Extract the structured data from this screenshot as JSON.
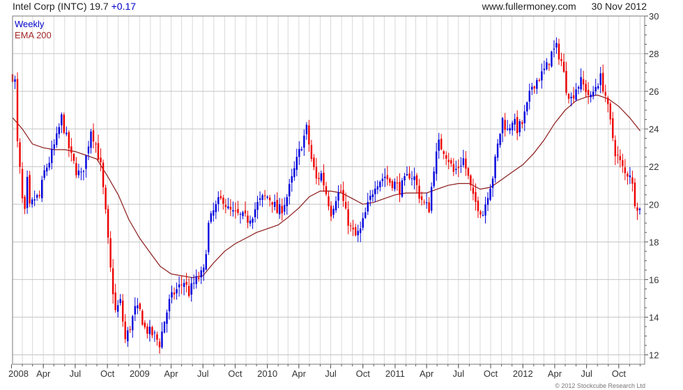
{
  "header": {
    "symbol": "Intel Corp (INTC)",
    "last": "19.7",
    "change": "+0.17",
    "website": "www.fullermoney.com",
    "date": "30 Nov 2012"
  },
  "legend": {
    "weekly": "Weekly",
    "ema": "EMA 200"
  },
  "copyright": "© 2012 Stockcube Research Ltd",
  "colors": {
    "up": "#0000dd",
    "down": "#ee0000",
    "ema": "#8b1a1a",
    "grid": "#d9d9d9",
    "axis": "#555555"
  },
  "chart_data": {
    "type": "candlestick",
    "title": "Intel Corp (INTC)",
    "interval": "Weekly",
    "ylim": [
      11.5,
      30
    ],
    "y_ticks": [
      12,
      14,
      16,
      18,
      20,
      22,
      24,
      26,
      28,
      30
    ],
    "x_tick_labels": [
      "2008",
      "Apr",
      "Jul",
      "Oct",
      "2009",
      "Apr",
      "Jul",
      "Oct",
      "2010",
      "Apr",
      "Jul",
      "Oct",
      "2011",
      "Apr",
      "Jul",
      "Oct",
      "2012",
      "Apr",
      "Jul",
      "Oct"
    ],
    "x_start": "2008-01-04",
    "x_end": "2012-12-14",
    "grid": true,
    "series": [
      {
        "name": "Weekly",
        "kind": "weekly-closing-price-path",
        "points": [
          [
            "2008-01-04",
            26.8
          ],
          [
            "2008-01-11",
            26.5
          ],
          [
            "2008-01-18",
            23.2
          ],
          [
            "2008-01-25",
            21.8
          ],
          [
            "2008-02-01",
            20.2
          ],
          [
            "2008-02-08",
            19.5
          ],
          [
            "2008-02-15",
            21.2
          ],
          [
            "2008-02-22",
            19.8
          ],
          [
            "2008-03-07",
            20.3
          ],
          [
            "2008-03-21",
            20.4
          ],
          [
            "2008-04-04",
            21.7
          ],
          [
            "2008-04-18",
            22.3
          ],
          [
            "2008-05-09",
            23.5
          ],
          [
            "2008-05-23",
            24.6
          ],
          [
            "2008-06-06",
            23.5
          ],
          [
            "2008-06-20",
            22.5
          ],
          [
            "2008-07-04",
            21.8
          ],
          [
            "2008-07-18",
            21.5
          ],
          [
            "2008-08-01",
            22.5
          ],
          [
            "2008-08-15",
            24.0
          ],
          [
            "2008-08-29",
            23.2
          ],
          [
            "2008-09-12",
            22.0
          ],
          [
            "2008-09-26",
            19.5
          ],
          [
            "2008-10-10",
            16.5
          ],
          [
            "2008-10-24",
            14.3
          ],
          [
            "2008-11-07",
            14.8
          ],
          [
            "2008-11-21",
            12.8
          ],
          [
            "2008-12-05",
            13.5
          ],
          [
            "2008-12-19",
            14.4
          ],
          [
            "2009-01-02",
            14.3
          ],
          [
            "2009-01-16",
            13.4
          ],
          [
            "2009-01-30",
            13.2
          ],
          [
            "2009-02-13",
            13.0
          ],
          [
            "2009-02-27",
            12.6
          ],
          [
            "2009-03-13",
            13.8
          ],
          [
            "2009-03-27",
            14.8
          ],
          [
            "2009-04-10",
            15.3
          ],
          [
            "2009-04-24",
            15.6
          ],
          [
            "2009-05-08",
            15.9
          ],
          [
            "2009-05-22",
            15.3
          ],
          [
            "2009-06-05",
            15.8
          ],
          [
            "2009-06-19",
            16.1
          ],
          [
            "2009-07-03",
            16.4
          ],
          [
            "2009-07-17",
            18.9
          ],
          [
            "2009-07-31",
            19.6
          ],
          [
            "2009-08-14",
            20.1
          ],
          [
            "2009-08-28",
            20.3
          ],
          [
            "2009-09-11",
            19.7
          ],
          [
            "2009-09-25",
            19.5
          ],
          [
            "2009-10-09",
            19.4
          ],
          [
            "2009-10-23",
            19.3
          ],
          [
            "2009-11-06",
            19.2
          ],
          [
            "2009-11-20",
            19.5
          ],
          [
            "2009-12-04",
            20.0
          ],
          [
            "2009-12-18",
            20.3
          ],
          [
            "2010-01-01",
            20.4
          ],
          [
            "2010-01-15",
            20.2
          ],
          [
            "2010-01-29",
            19.6
          ],
          [
            "2010-02-12",
            19.8
          ],
          [
            "2010-02-26",
            20.4
          ],
          [
            "2010-03-12",
            21.3
          ],
          [
            "2010-03-26",
            22.3
          ],
          [
            "2010-04-09",
            23.2
          ],
          [
            "2010-04-23",
            24.0
          ],
          [
            "2010-05-07",
            22.4
          ],
          [
            "2010-05-21",
            21.3
          ],
          [
            "2010-06-04",
            21.6
          ],
          [
            "2010-06-18",
            20.6
          ],
          [
            "2010-07-02",
            19.6
          ],
          [
            "2010-07-16",
            20.4
          ],
          [
            "2010-07-30",
            20.7
          ],
          [
            "2010-08-13",
            19.5
          ],
          [
            "2010-08-27",
            18.7
          ],
          [
            "2010-09-10",
            18.3
          ],
          [
            "2010-09-24",
            18.6
          ],
          [
            "2010-10-08",
            19.5
          ],
          [
            "2010-10-22",
            20.3
          ],
          [
            "2010-11-05",
            21.1
          ],
          [
            "2010-11-19",
            21.3
          ],
          [
            "2010-12-03",
            21.5
          ],
          [
            "2010-12-17",
            21.2
          ],
          [
            "2010-12-31",
            21.1
          ],
          [
            "2011-01-14",
            20.8
          ],
          [
            "2011-01-28",
            21.2
          ],
          [
            "2011-02-11",
            21.6
          ],
          [
            "2011-02-25",
            21.4
          ],
          [
            "2011-03-11",
            20.5
          ],
          [
            "2011-03-25",
            20.0
          ],
          [
            "2011-04-08",
            19.8
          ],
          [
            "2011-04-22",
            22.0
          ],
          [
            "2011-05-06",
            23.2
          ],
          [
            "2011-05-20",
            22.9
          ],
          [
            "2011-06-03",
            22.4
          ],
          [
            "2011-06-17",
            21.7
          ],
          [
            "2011-07-01",
            22.0
          ],
          [
            "2011-07-15",
            22.4
          ],
          [
            "2011-07-29",
            21.4
          ],
          [
            "2011-08-12",
            20.3
          ],
          [
            "2011-08-26",
            19.9
          ],
          [
            "2011-09-09",
            19.5
          ],
          [
            "2011-09-23",
            20.6
          ],
          [
            "2011-10-07",
            21.5
          ],
          [
            "2011-10-21",
            23.1
          ],
          [
            "2011-11-04",
            24.5
          ],
          [
            "2011-11-18",
            23.9
          ],
          [
            "2011-12-02",
            24.5
          ],
          [
            "2011-12-16",
            24.0
          ],
          [
            "2011-12-30",
            24.3
          ],
          [
            "2012-01-13",
            25.2
          ],
          [
            "2012-01-27",
            26.3
          ],
          [
            "2012-02-10",
            26.6
          ],
          [
            "2012-02-24",
            26.9
          ],
          [
            "2012-03-09",
            27.3
          ],
          [
            "2012-03-23",
            28.0
          ],
          [
            "2012-04-06",
            28.3
          ],
          [
            "2012-04-20",
            27.6
          ],
          [
            "2012-05-04",
            26.2
          ],
          [
            "2012-05-18",
            25.6
          ],
          [
            "2012-06-01",
            26.2
          ],
          [
            "2012-06-15",
            26.5
          ],
          [
            "2012-06-29",
            26.1
          ],
          [
            "2012-07-13",
            25.6
          ],
          [
            "2012-07-27",
            26.3
          ],
          [
            "2012-08-10",
            26.7
          ],
          [
            "2012-08-24",
            25.8
          ],
          [
            "2012-09-07",
            24.3
          ],
          [
            "2012-09-21",
            22.8
          ],
          [
            "2012-10-05",
            22.2
          ],
          [
            "2012-10-19",
            21.6
          ],
          [
            "2012-11-02",
            21.7
          ],
          [
            "2012-11-16",
            20.2
          ],
          [
            "2012-11-30",
            19.7
          ]
        ]
      },
      {
        "name": "EMA 200",
        "kind": "line",
        "points": [
          [
            "2008-01-04",
            24.6
          ],
          [
            "2008-02-01",
            24.0
          ],
          [
            "2008-03-01",
            23.2
          ],
          [
            "2008-04-01",
            23.0
          ],
          [
            "2008-05-01",
            22.9
          ],
          [
            "2008-06-01",
            22.9
          ],
          [
            "2008-07-01",
            22.8
          ],
          [
            "2008-08-01",
            22.6
          ],
          [
            "2008-09-01",
            22.4
          ],
          [
            "2008-10-01",
            21.5
          ],
          [
            "2008-11-01",
            20.5
          ],
          [
            "2008-12-01",
            19.2
          ],
          [
            "2009-01-01",
            18.2
          ],
          [
            "2009-02-01",
            17.4
          ],
          [
            "2009-03-01",
            16.7
          ],
          [
            "2009-04-01",
            16.3
          ],
          [
            "2009-05-01",
            16.2
          ],
          [
            "2009-06-01",
            16.1
          ],
          [
            "2009-07-01",
            16.2
          ],
          [
            "2009-08-01",
            16.9
          ],
          [
            "2009-09-01",
            17.5
          ],
          [
            "2009-10-01",
            17.9
          ],
          [
            "2009-11-01",
            18.2
          ],
          [
            "2009-12-01",
            18.5
          ],
          [
            "2010-01-01",
            18.7
          ],
          [
            "2010-02-01",
            18.9
          ],
          [
            "2010-03-01",
            19.3
          ],
          [
            "2010-04-01",
            19.8
          ],
          [
            "2010-05-01",
            20.4
          ],
          [
            "2010-06-01",
            20.7
          ],
          [
            "2010-07-01",
            20.7
          ],
          [
            "2010-08-01",
            20.6
          ],
          [
            "2010-09-01",
            20.3
          ],
          [
            "2010-10-01",
            20.0
          ],
          [
            "2010-11-01",
            20.1
          ],
          [
            "2010-12-01",
            20.3
          ],
          [
            "2011-01-01",
            20.5
          ],
          [
            "2011-02-01",
            20.6
          ],
          [
            "2011-03-01",
            20.6
          ],
          [
            "2011-04-01",
            20.6
          ],
          [
            "2011-05-01",
            20.8
          ],
          [
            "2011-06-01",
            21.0
          ],
          [
            "2011-07-01",
            21.1
          ],
          [
            "2011-08-01",
            21.1
          ],
          [
            "2011-09-01",
            20.8
          ],
          [
            "2011-10-01",
            20.9
          ],
          [
            "2011-11-01",
            21.3
          ],
          [
            "2011-12-01",
            21.7
          ],
          [
            "2012-01-01",
            22.1
          ],
          [
            "2012-02-01",
            22.7
          ],
          [
            "2012-03-01",
            23.4
          ],
          [
            "2012-04-01",
            24.3
          ],
          [
            "2012-05-01",
            25.0
          ],
          [
            "2012-06-01",
            25.5
          ],
          [
            "2012-07-01",
            25.7
          ],
          [
            "2012-08-01",
            25.8
          ],
          [
            "2012-09-01",
            25.6
          ],
          [
            "2012-10-01",
            25.2
          ],
          [
            "2012-11-01",
            24.6
          ],
          [
            "2012-12-01",
            23.9
          ]
        ]
      }
    ]
  }
}
